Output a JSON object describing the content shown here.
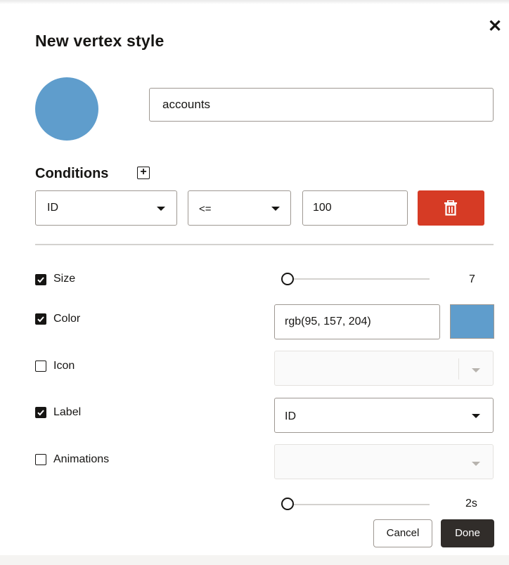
{
  "dialog": {
    "title": "New vertex style",
    "close_glyph": "✕",
    "name_value": "accounts",
    "swatch_color": "#5f9dcc"
  },
  "conditions": {
    "title": "Conditions",
    "add_glyph": "+",
    "field_value": "ID",
    "operator_value": "<=",
    "compare_value": "100",
    "delete_color": "#d63b25"
  },
  "properties": {
    "size": {
      "label": "Size",
      "checked": true,
      "value": "7",
      "level_fraction": 0.0
    },
    "color": {
      "label": "Color",
      "checked": true,
      "value": "rgb(95, 157, 204)",
      "swatch": "#5f9dcc"
    },
    "icon": {
      "label": "Icon",
      "checked": false,
      "value": ""
    },
    "label": {
      "label": "Label",
      "checked": true,
      "value": "ID"
    },
    "animations": {
      "label": "Animations",
      "checked": false,
      "value": "",
      "duration_partial": "2s",
      "level_fraction": 0.0
    }
  },
  "footer": {
    "cancel_label": "Cancel",
    "done_label": "Done"
  },
  "icons": [
    "close-icon",
    "add-condition-icon",
    "trash-icon",
    "checkbox-checked-icon",
    "checkbox-empty-icon",
    "chevron-down-icon"
  ]
}
